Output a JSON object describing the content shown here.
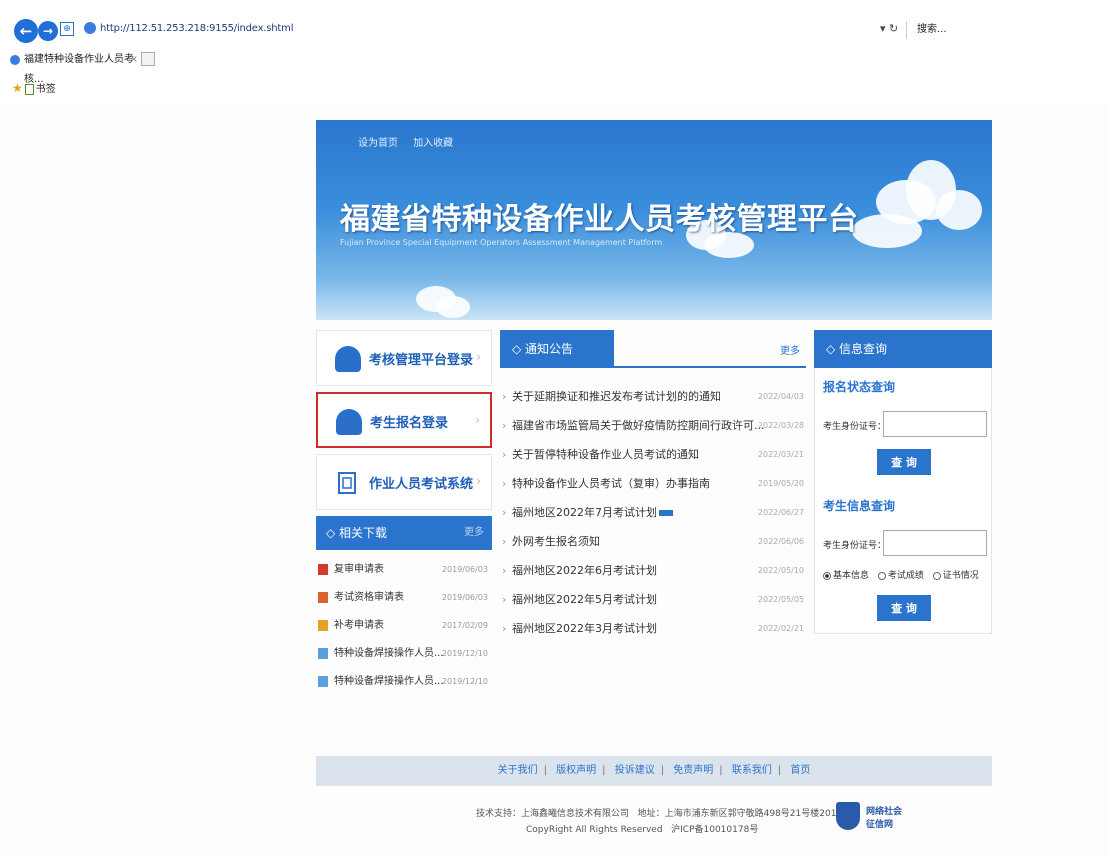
{
  "browser": {
    "url": "http://112.51.253.218:9155/index.shtml",
    "refresh": "▾ ↻",
    "search_placeholder": "搜索...",
    "tab_title": "福建特种设备作业人员考核...",
    "tab_close": "×",
    "favorites_label": "书签"
  },
  "banner": {
    "top_links": [
      "设为首页",
      "加入收藏"
    ],
    "title": "福建省特种设备作业人员考核管理平台",
    "subtitle": "Fujian Province Special Equipment Operators Assessment Management Platform"
  },
  "left": {
    "logins": [
      {
        "label": "考核管理平台登录",
        "arrow": "›"
      },
      {
        "label": "考生报名登录",
        "arrow": "›"
      },
      {
        "label": "作业人员考试系统",
        "arrow": "›"
      }
    ],
    "downloads_title": "◇ 相关下载",
    "downloads_more": "更多",
    "downloads": [
      {
        "name": "复审申请表",
        "date": "2019/06/03",
        "color": "#d23a2a"
      },
      {
        "name": "考试资格审请表",
        "date": "2019/06/03",
        "color": "#e0622a"
      },
      {
        "name": "补考申请表",
        "date": "2017/02/09",
        "color": "#e8a020"
      },
      {
        "name": "特种设备焊接操作人员...",
        "date": "2019/12/10",
        "color": "#5aa0dc"
      },
      {
        "name": "特种设备焊接操作人员...",
        "date": "2019/12/10",
        "color": "#5aa0dc"
      }
    ]
  },
  "notices": {
    "title": "◇ 通知公告",
    "more": "更多",
    "items": [
      {
        "text": "关于延期换证和推迟发布考试计划的的通知",
        "date": "2022/04/03",
        "new": false
      },
      {
        "text": "福建省市场监管局关于做好疫情防控期间行政许可...",
        "date": "2022/03/28",
        "new": false
      },
      {
        "text": "关于暂停特种设备作业人员考试的通知",
        "date": "2022/03/21",
        "new": false
      },
      {
        "text": "特种设备作业人员考试（复审）办事指南",
        "date": "2019/05/20",
        "new": false
      },
      {
        "text": "福州地区2022年7月考试计划",
        "date": "2022/06/27",
        "new": true
      },
      {
        "text": "外网考生报名须知",
        "date": "2022/06/06",
        "new": false
      },
      {
        "text": "福州地区2022年6月考试计划",
        "date": "2022/05/10",
        "new": false
      },
      {
        "text": "福州地区2022年5月考试计划",
        "date": "2022/05/05",
        "new": false
      },
      {
        "text": "福州地区2022年3月考试计划",
        "date": "2022/02/21",
        "new": false
      }
    ]
  },
  "query": {
    "title": "◇ 信息查询",
    "reg_status_title": "报名状态查询",
    "id_label": "考生身份证号：",
    "query_button": "查 询",
    "exam_info_title": "考生信息查询",
    "id_label_2": "考生身份证号：",
    "radio_options": [
      "基本信息",
      "考试成绩",
      "证书情况"
    ],
    "radio_selected": 0,
    "query_button_2": "查 询"
  },
  "footer": {
    "links": [
      "关于我们",
      "版权声明",
      "投诉建议",
      "免责声明",
      "联系我们",
      "首页"
    ],
    "support": "技术支持：上海鑫曦信息技术有限公司",
    "address": "地址：上海市浦东新区郭守敬路498号21号楼201室",
    "copyright": "CopyRight All Rights Reserved",
    "icp": "沪ICP备10010178号",
    "badge_line1": "网络社会",
    "badge_line2": "征信网"
  },
  "colors": {
    "accent": "#2b74cd",
    "highlight_border": "#d02a2a"
  }
}
